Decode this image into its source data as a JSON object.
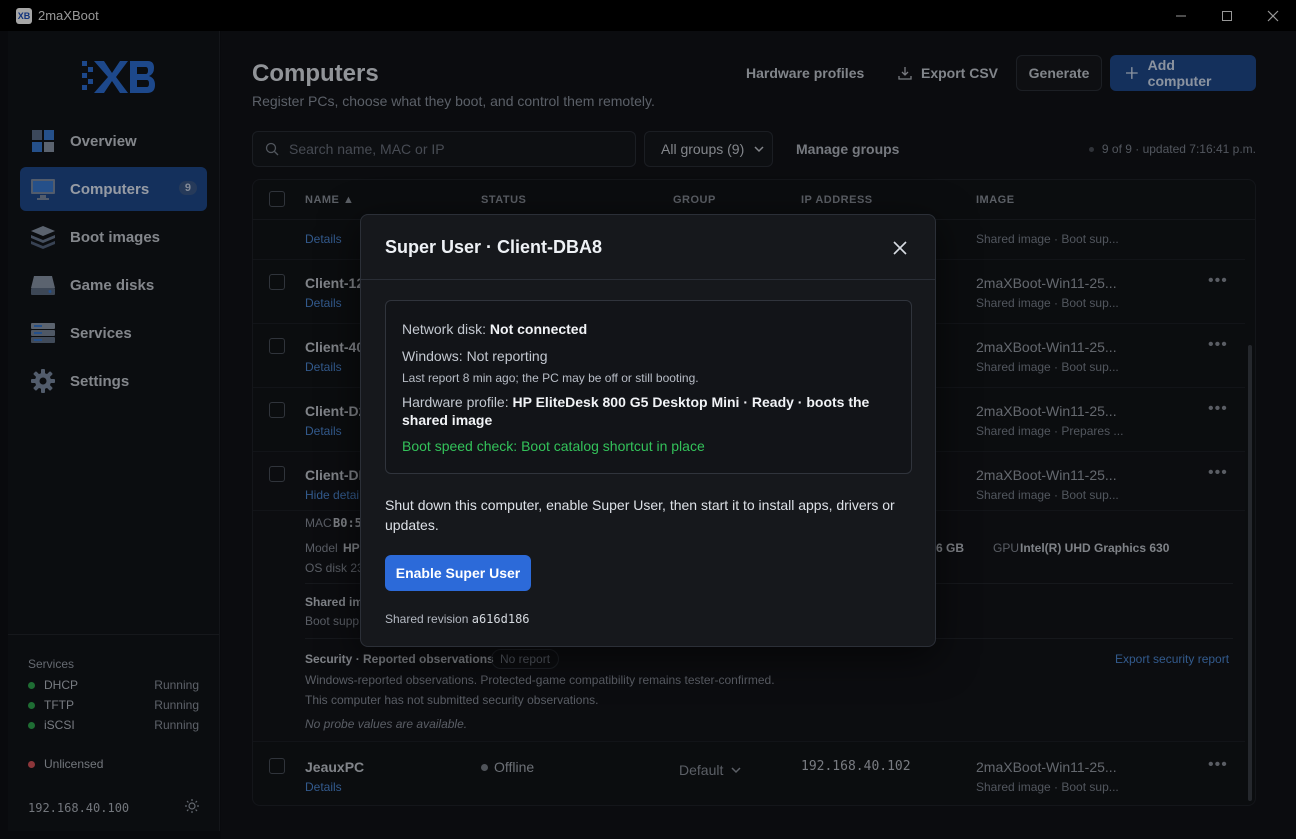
{
  "window": {
    "title": "2maXBoot",
    "app_icon": "XB"
  },
  "sidebar": {
    "logo_text": "XB",
    "items": [
      {
        "label": "Overview",
        "icon": "overview-icon",
        "badge": ""
      },
      {
        "label": "Computers",
        "icon": "monitor-icon",
        "badge": "9"
      },
      {
        "label": "Boot images",
        "icon": "stack-icon",
        "badge": ""
      },
      {
        "label": "Game disks",
        "icon": "disk-icon",
        "badge": ""
      },
      {
        "label": "Services",
        "icon": "server-icon",
        "badge": ""
      },
      {
        "label": "Settings",
        "icon": "gear-icon",
        "badge": ""
      }
    ],
    "services_title": "Services",
    "services": [
      {
        "name": "DHCP",
        "state": "Running"
      },
      {
        "name": "TFTP",
        "state": "Running"
      },
      {
        "name": "iSCSI",
        "state": "Running"
      }
    ],
    "license": "Unlicensed",
    "server_ip": "192.168.40.100"
  },
  "header": {
    "title": "Computers",
    "subtitle": "Register PCs, choose what they boot, and control them remotely.",
    "hardware_profiles": "Hardware profiles",
    "export_csv": "Export CSV",
    "generate": "Generate",
    "add_computer": "Add computer"
  },
  "filters": {
    "search_placeholder": "Search name, MAC or IP",
    "group_select": "All groups (9)",
    "manage_groups": "Manage groups",
    "status": "9 of 9 · updated 7:16:41 p.m."
  },
  "table": {
    "columns": [
      "NAME ▲",
      "STATUS",
      "GROUP",
      "IP ADDRESS",
      "IMAGE"
    ],
    "rows": [
      {
        "name": "Client-12",
        "details": "Details",
        "image": "2maXBoot-Win11-25...",
        "image_sub": "Shared image · Boot sup..."
      },
      {
        "name": "Client-40",
        "details": "Details",
        "image": "2maXBoot-Win11-25...",
        "image_sub": "Shared image · Boot sup..."
      },
      {
        "name": "Client-D2",
        "details": "Details",
        "image": "2maXBoot-Win11-25...",
        "image_sub": "Shared image · Prepares ..."
      },
      {
        "name": "Client-DI",
        "details": "Hide detai",
        "image": "2maXBoot-Win11-25...",
        "image_sub": "Shared image · Boot sup..."
      }
    ],
    "top_partial": {
      "details": "Details",
      "image_sub": "Shared image · Boot sup..."
    },
    "expanded": {
      "mac_label": "MAC",
      "mac_value": "B0:5",
      "model_label": "Model",
      "model_value": "HP",
      "os_disk": "OS disk 23",
      "ram_tail": "6 GB",
      "gpu_label": "GPU",
      "gpu_value": "Intel(R) UHD Graphics 630",
      "shared_label": "Shared im",
      "boot_supp": "Boot supp",
      "security_title": "Security · Reported observations",
      "security_badge": "No report",
      "export_security": "Export security report",
      "obs_line1": "Windows-reported observations. Protected-game compatibility remains tester-confirmed.",
      "obs_line2": "This computer has not submitted security observations.",
      "obs_line3": "No probe values are available."
    },
    "last_row": {
      "name": "JeauxPC",
      "details": "Details",
      "status": "Offline",
      "group": "Default",
      "ip": "192.168.40.102",
      "image": "2maXBoot-Win11-25...",
      "image_sub": "Shared image · Boot sup..."
    }
  },
  "modal": {
    "title": "Super User · Client-DBA8",
    "network_disk_label": "Network disk:",
    "network_disk_value": "Not connected",
    "windows_line": "Windows: Not reporting",
    "last_report": "Last report 8 min ago; the PC may be off or still booting.",
    "hardware_label": "Hardware profile:",
    "hardware_value": "HP EliteDesk 800 G5 Desktop Mini · Ready · boots the shared image",
    "boot_speed": "Boot speed check: Boot catalog shortcut in place",
    "description": "Shut down this computer, enable Super User, then start it to install apps, drivers or updates.",
    "button": "Enable Super User",
    "revision_label": "Shared revision",
    "revision_value": "a616d186"
  },
  "colors": {
    "accent": "#2c6ad9",
    "nav_active": "#1f4b8e",
    "running": "#2fa84f",
    "unlicensed": "#d9545a",
    "green_text": "#33c25a"
  }
}
